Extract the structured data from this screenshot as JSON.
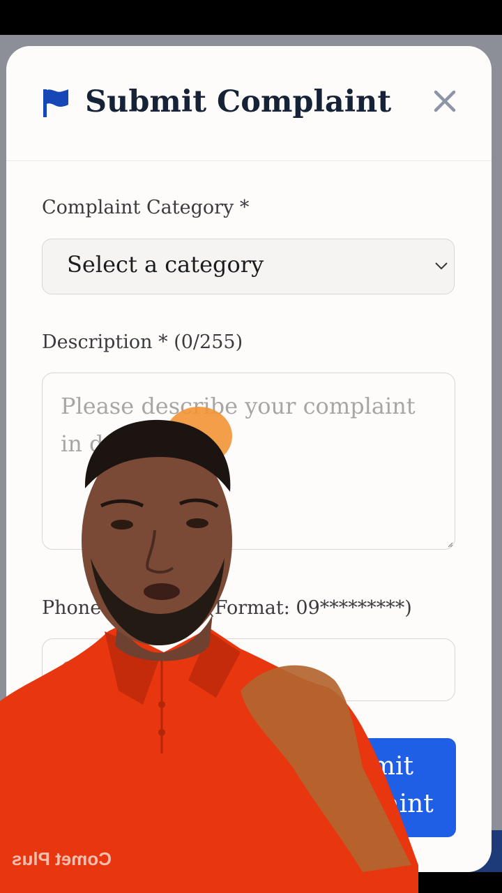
{
  "modal": {
    "title": "Submit Complaint",
    "close_icon": "close-icon",
    "flag_icon": "flag-icon"
  },
  "form": {
    "category_label": "Complaint Category *",
    "category_selected": "Select a category",
    "description_label": "Description * (0/255)",
    "description_placeholder": "Please describe your complaint in detail...",
    "phone_label": "Phone Number * (Format: 09*********)",
    "phone_placeholder": "09*********",
    "submit_label": "Submit Complaint"
  },
  "overlay": {
    "shirt_text": "Comet Plus"
  },
  "colors": {
    "accent": "#1f5fe6",
    "flag": "#1747b7",
    "title": "#162236",
    "shirt": "#e8360f"
  }
}
